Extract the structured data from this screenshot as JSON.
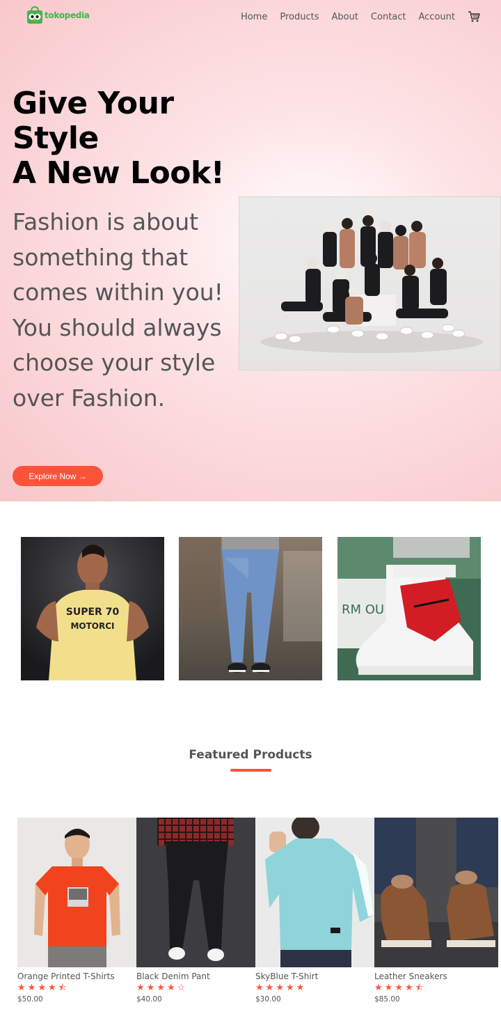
{
  "brand": {
    "name": "tokopedia"
  },
  "nav": {
    "items": [
      "Home",
      "Products",
      "About",
      "Contact",
      "Account"
    ]
  },
  "hero": {
    "headline_line1": "Give Your",
    "headline_line2": "Style",
    "headline_line3": "A New Look!",
    "tagline": "Fashion is about something that comes within you! You should always choose your style over Fashion.",
    "cta_label": "Explore Now →"
  },
  "featured": {
    "title": "Featured Products",
    "products": [
      {
        "name": "Orange Printed T-Shirts",
        "rating": 4.5,
        "price": "$50.00"
      },
      {
        "name": "Black Denim Pant",
        "rating": 4,
        "price": "$40.00"
      },
      {
        "name": "SkyBlue T-Shirt",
        "rating": 5,
        "price": "$30.00"
      },
      {
        "name": "Leather Sneakers",
        "rating": 4.5,
        "price": "$85.00"
      }
    ]
  },
  "colors": {
    "accent": "#ff523b",
    "brand": "#42b549"
  }
}
